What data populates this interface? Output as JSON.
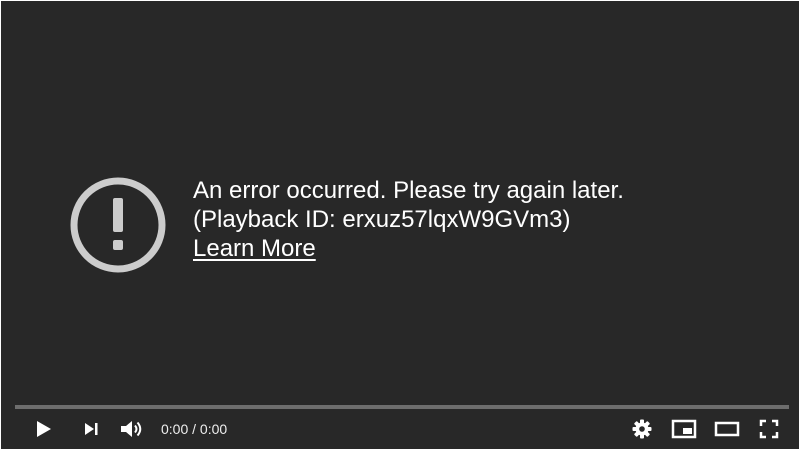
{
  "error": {
    "message": "An error occurred. Please try again later.",
    "playback_id": "(Playback ID: erxuz57lqxW9GVm3)",
    "learn_more": "Learn More",
    "icon": "exclamation-circle-icon"
  },
  "controls": {
    "current_time": "0:00",
    "separator": " / ",
    "duration": "0:00",
    "icons": [
      "play-icon",
      "next-icon",
      "volume-icon",
      "settings-icon",
      "miniplayer-icon",
      "theater-mode-icon",
      "fullscreen-icon"
    ]
  },
  "colors": {
    "background": "#282828",
    "text": "#ffffff",
    "icon_gray": "#cccccc"
  }
}
